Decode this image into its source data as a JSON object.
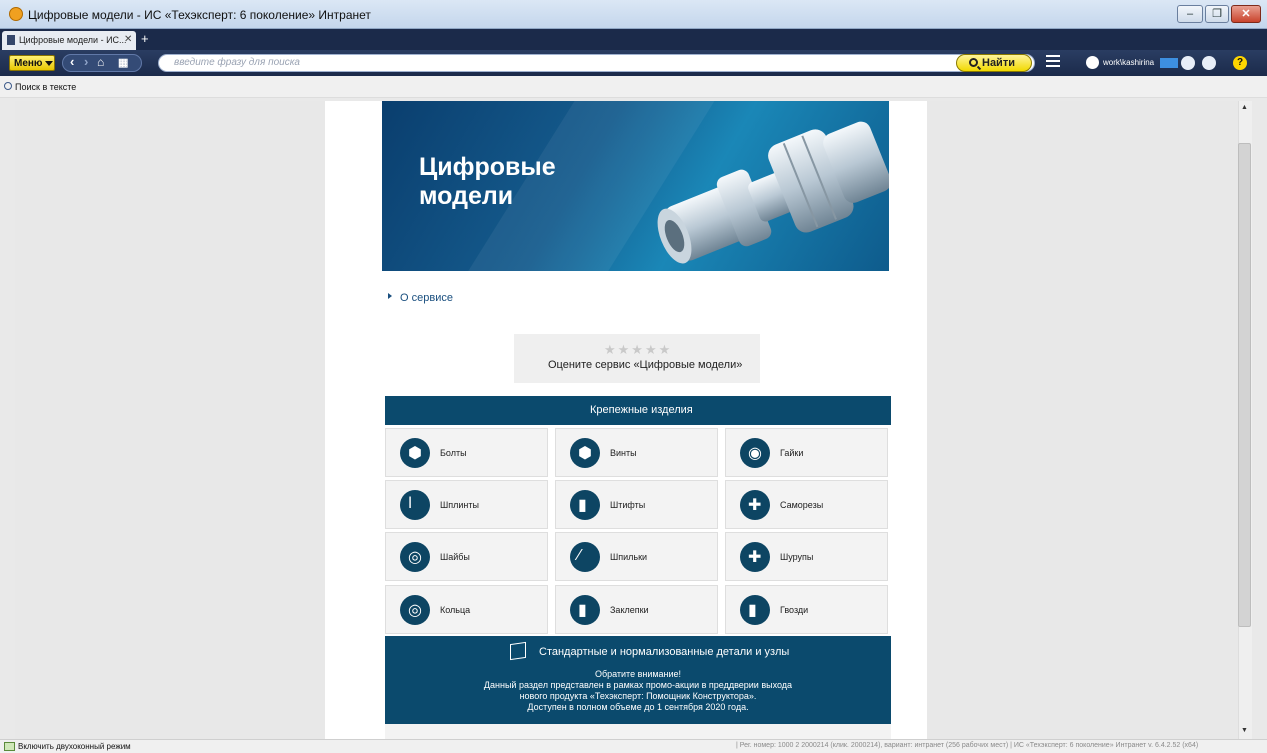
{
  "window": {
    "title": "Цифровые модели - ИС «Техэксперт: 6 поколение» Интранет"
  },
  "tabs": [
    {
      "label": "Цифровые модели - ИС..."
    }
  ],
  "toolbar": {
    "menu_label": "Меню",
    "search_placeholder": "введите фразу для поиска",
    "find_label": "Найти",
    "username": "work\\kashirina"
  },
  "findbar": {
    "label": "Поиск в тексте"
  },
  "banner": {
    "title": "Цифровые\nмодели"
  },
  "about_link": "О сервисе",
  "rating": {
    "stars": "★★★★★",
    "label": "Оцените сервис «Цифровые модели»"
  },
  "category": {
    "title": "Крепежные изделия",
    "items": [
      {
        "label": "Болты",
        "icon": "bolt-icon"
      },
      {
        "label": "Винты",
        "icon": "screw-icon"
      },
      {
        "label": "Гайки",
        "icon": "nut-icon"
      },
      {
        "label": "Шплинты",
        "icon": "cotter-pin-icon"
      },
      {
        "label": "Штифты",
        "icon": "pin-icon"
      },
      {
        "label": "Саморезы",
        "icon": "self-tapping-screw-icon"
      },
      {
        "label": "Шайбы",
        "icon": "washer-icon"
      },
      {
        "label": "Шпильки",
        "icon": "stud-icon"
      },
      {
        "label": "Шурупы",
        "icon": "wood-screw-icon"
      },
      {
        "label": "Кольца",
        "icon": "ring-icon"
      },
      {
        "label": "Заклепки",
        "icon": "rivet-icon"
      },
      {
        "label": "Гвозди",
        "icon": "nail-icon"
      }
    ]
  },
  "section2": {
    "title": "Стандартные и нормализованные детали и узлы",
    "note": "Обратите внимание!\nДанный раздел представлен в рамках промо-акции в преддверии выхода\nнового продукта «Техэксперт: Помощник Конструктора».\nДоступен в полном объеме до 1 сентября 2020 года."
  },
  "statusbar": {
    "left": "Включить двухоконный режим",
    "right": "|   Рег. номер: 1000 2 2000214 (клик. 2000214), вариант: интранет (256 рабочих мест)   |   ИС «Техэксперт: 6 поколение» Интранет v. 6.4.2.52 (x64)"
  },
  "colors": {
    "accent_dark": "#0b4a6d",
    "find_button": "#f1d900",
    "toolbar_bg": "#1b2a4a"
  }
}
